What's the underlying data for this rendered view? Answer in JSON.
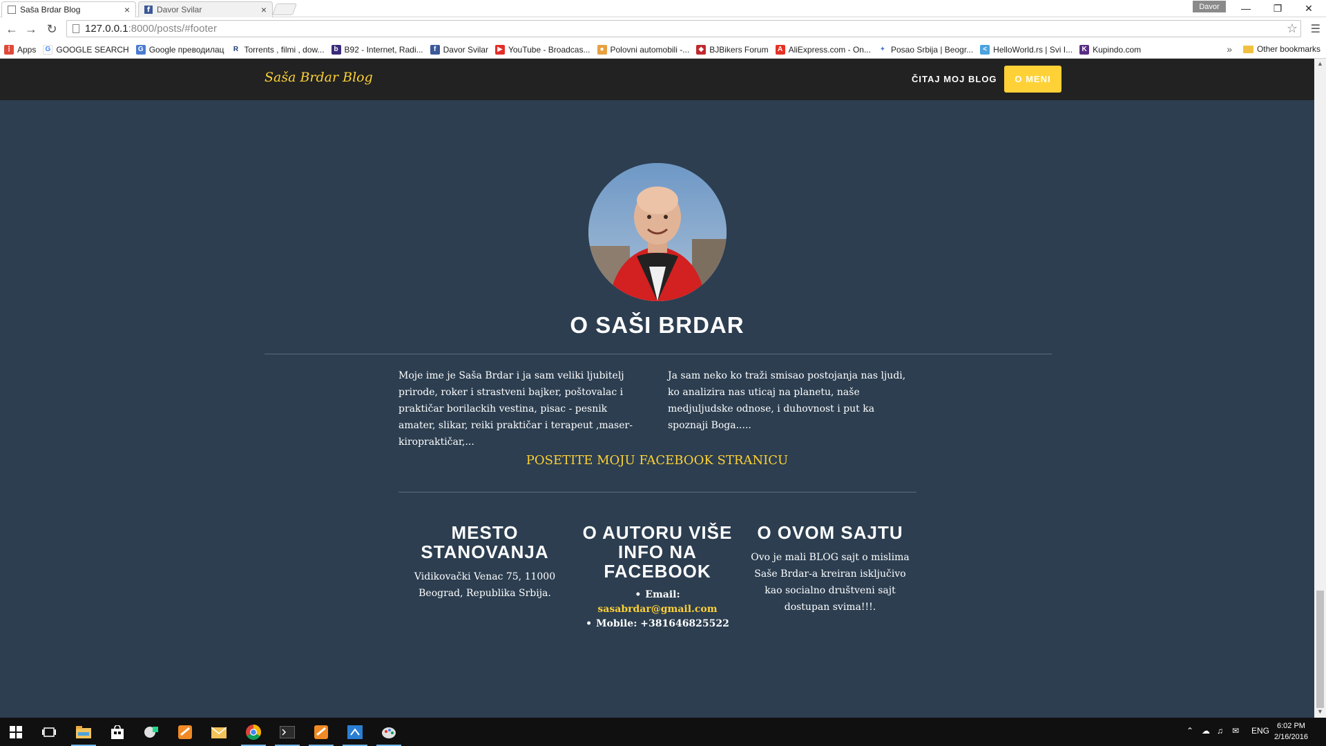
{
  "browser": {
    "tabs": [
      {
        "title": "Saša Brdar Blog",
        "active": true
      },
      {
        "title": "Davor Svilar",
        "active": false
      }
    ],
    "profile": "Davor",
    "url_host": "127.0.0.1",
    "url_rest": ":8000/posts/#footer",
    "bookmarks": [
      {
        "label": "Apps",
        "icon": "apps-grid-icon",
        "color": "#e0493a"
      },
      {
        "label": "GOOGLE SEARCH",
        "icon": "google-icon",
        "color": "#4285f4"
      },
      {
        "label": "Google преводилац",
        "icon": "translate-icon",
        "color": "#4a7bd0"
      },
      {
        "label": "Torrents , filmi , dow...",
        "icon": "r-icon",
        "color": "#1a3c6e"
      },
      {
        "label": "B92 - Internet, Radi...",
        "icon": "b92-icon",
        "color": "#3b2a7a"
      },
      {
        "label": "Davor Svilar",
        "icon": "facebook-icon",
        "color": "#3b5998"
      },
      {
        "label": "YouTube - Broadcas...",
        "icon": "youtube-icon",
        "color": "#e52d27"
      },
      {
        "label": "Polovni automobili -...",
        "icon": "car-icon",
        "color": "#e8a040"
      },
      {
        "label": "BJBikers Forum",
        "icon": "shield-icon",
        "color": "#c0282d"
      },
      {
        "label": "AliExpress.com - On...",
        "icon": "aliexpress-icon",
        "color": "#e43225"
      },
      {
        "label": "Posao Srbija | Beogr...",
        "icon": "runner-icon",
        "color": "#4a7bd0"
      },
      {
        "label": "HelloWorld.rs | Svi I...",
        "icon": "code-icon",
        "color": "#4aa3df"
      },
      {
        "label": "Kupindo.com",
        "icon": "kupindo-icon",
        "color": "#5a2d82"
      }
    ],
    "other_bookmarks": "Other bookmarks"
  },
  "site": {
    "brand": "Saša Brdar Blog",
    "nav_link": "ČITAJ MOJ BLOG",
    "nav_button": "O MENI",
    "about_title": "O SAŠI BRDAR",
    "about_left": "Moje ime je Saša Brdar i ja sam veliki ljubitelj prirode, roker i strastveni bajker, poštovalac i praktičar borilackih vestina, pisac - pesnik amater, slikar, reiki praktičar i terapeut ,maser-kiropraktičar,...",
    "about_right": "Ja sam neko ko traži smisao postojanja nas ljudi, ko analizira nas uticaj na planetu, naše medjuljudske odnose, i duhovnost i put ka spoznaji Boga.....",
    "facebook_link": "POSETITE MOJU FACEBOOK STRANICU",
    "footer": {
      "location_title": "MESTO STANOVANJA",
      "location_text": "Vidikovački Venac 75, 11000 Beograd, Republika Srbija.",
      "author_title": "O AUTORU VIŠE INFO NA FACEBOOK",
      "email_label": "Email:",
      "email_value": "sasabrdar@gmail.com",
      "mobile_label": "Mobile: +381646825522",
      "site_title": "O OVOM SAJTU",
      "site_text": "Ovo je mali BLOG sajt o mislima Saše Brdar-a kreiran isključivo kao socialno društveni sajt dostupan svima!!!."
    },
    "accent_color": "#fed136",
    "bg_color": "#2c3e50"
  },
  "taskbar": {
    "language": "ENG",
    "time": "6:02 PM",
    "date": "2/16/2016"
  }
}
